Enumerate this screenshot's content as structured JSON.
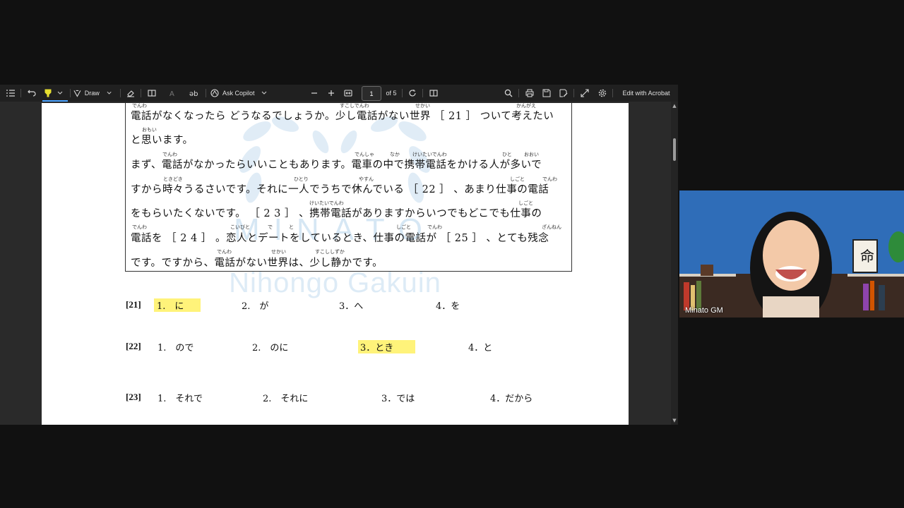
{
  "toolbar": {
    "draw_label": "Draw",
    "ask_copilot_label": "Ask Copilot",
    "page_current": "1",
    "page_total": "of 5",
    "edit_acrobat_label": "Edit with Acrobat"
  },
  "watermark": {
    "logo_text": "MINATO",
    "subtitle": "Nihongo Gakuin"
  },
  "passage": {
    "lines": [
      "電話がなくなったら どうなるでしょうか。少し電話がない世界 ［ 21 ］ ついて考えたい",
      "と思います。",
      "まず、電話がなかったらいいこともあります。電車の中で携帯電話をかける人が多いで",
      "すから時々うるさいです。それに一人でうちで休んでいる ［ 22 ］ 、あまり仕事の電話",
      "をもらいたくないです。 ［ 2 3 ］ 、携帯電話がありますからいつでもどこでも仕事の",
      "電話を ［ 2 4 ］ 。恋人とデートをしているとき、仕事の電話が ［ 25 ］ 、とても残念",
      "です。ですから、電話がない世界は、少し静かです。"
    ],
    "furigana": [
      "でんわ",
      "すこしでんわ",
      "せかい",
      "かんがえ",
      "おもい",
      "でんわ",
      "でんしゃ",
      "なか",
      "けいたいでんわ",
      "ひと",
      "おおい",
      "ときどき",
      "ひとり",
      "やすん",
      "しごと",
      "でんわ",
      "けいたいでんわ",
      "しごと",
      "でんわ",
      "こいびと",
      "で",
      "と",
      "しごと",
      "でんわ",
      "ざんねん",
      "でんわ",
      "せかい",
      "すこししずか"
    ]
  },
  "questions": [
    {
      "num": "[21]",
      "options": [
        "1.　に",
        "2.　が",
        "3．へ",
        "4．を"
      ],
      "selected_index": 0
    },
    {
      "num": "[22]",
      "options": [
        "1.　ので",
        "2.　のに",
        "3．とき",
        "4．と"
      ],
      "selected_index": 2
    },
    {
      "num": "[23]",
      "options": [
        "1.　それで",
        "2.　それに",
        "3．では",
        "4．だから"
      ],
      "selected_index": -1
    }
  ],
  "video": {
    "participant_name": "Minato GM"
  },
  "colors": {
    "toolbar_bg": "#202020",
    "viewer_bg": "#2a2a2a",
    "highlight": "#fff37a",
    "watermark": "#b6d4ec"
  }
}
